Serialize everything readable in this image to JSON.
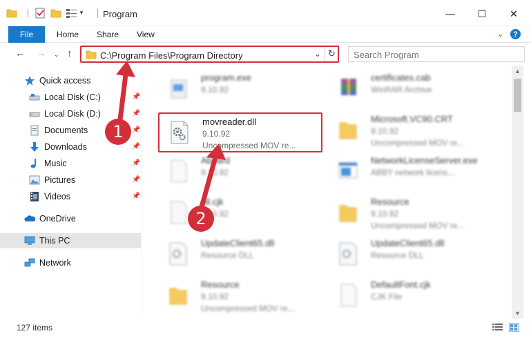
{
  "window": {
    "title": "Program",
    "minimize": "—",
    "maximize": "☐",
    "close": "✕"
  },
  "ribbon": {
    "file": "File",
    "tabs": [
      "Home",
      "Share",
      "View"
    ],
    "expand": "⌄",
    "help": "?"
  },
  "address": {
    "path": "C:\\Program Files\\Program Directory",
    "search_placeholder": "Search Program"
  },
  "nav": {
    "items": [
      {
        "label": "Quick access",
        "icon": "star-icon",
        "pinned": false
      },
      {
        "label": "Local Disk (C:)",
        "icon": "drive-icon",
        "pinned": true
      },
      {
        "label": "Local Disk (D:)",
        "icon": "drive-icon",
        "pinned": true
      },
      {
        "label": "Documents",
        "icon": "documents-icon",
        "pinned": true
      },
      {
        "label": "Downloads",
        "icon": "download-icon",
        "pinned": true
      },
      {
        "label": "Music",
        "icon": "music-icon",
        "pinned": true
      },
      {
        "label": "Pictures",
        "icon": "pictures-icon",
        "pinned": true
      },
      {
        "label": "Videos",
        "icon": "videos-icon",
        "pinned": true
      },
      {
        "label": "OneDrive",
        "icon": "cloud-icon",
        "pinned": false
      },
      {
        "label": "This PC",
        "icon": "computer-icon",
        "pinned": false,
        "selected": true
      },
      {
        "label": "Network",
        "icon": "network-icon",
        "pinned": false
      }
    ]
  },
  "files": [
    {
      "name": "program.exe",
      "sub1": "9.10.92",
      "sub2": "",
      "icon": "exe-icon",
      "blurred": true
    },
    {
      "name": "certificates.cab",
      "sub1": "WinRAR Archive",
      "sub2": "",
      "icon": "archive-icon",
      "blurred": true
    },
    {
      "name": "movreader.dll",
      "sub1": "9.10.92",
      "sub2": "Uncompressed MOV re...",
      "icon": "dll-gear-icon",
      "blurred": false
    },
    {
      "name": "Microsoft.VC90.CRT",
      "sub1": "9.10.92",
      "sub2": "Uncompressed MOV re...",
      "icon": "folder-icon",
      "blurred": true
    },
    {
      "name": "Aboard",
      "sub1": "9.10.92",
      "sub2": "",
      "icon": "file-icon",
      "blurred": true
    },
    {
      "name": "NetworkLicenseServer.exe",
      "sub1": "ABBY network licens...",
      "sub2": "",
      "icon": "app-window-icon",
      "blurred": true
    },
    {
      "name": "dll.cjk",
      "sub1": "9.10.92",
      "sub2": "",
      "icon": "file-icon",
      "blurred": true
    },
    {
      "name": "Resource",
      "sub1": "9.10.92",
      "sub2": "Uncompressed MOV re...",
      "icon": "folder-icon",
      "blurred": true
    },
    {
      "name": "UpdateClient65.dll",
      "sub1": "Resource DLL",
      "sub2": "",
      "icon": "dll-gear-icon",
      "blurred": true
    },
    {
      "name": "UpdateClient65.dll",
      "sub1": "Resource DLL",
      "sub2": "",
      "icon": "dll-gear-icon",
      "blurred": true
    },
    {
      "name": "Resource",
      "sub1": "9.10.92",
      "sub2": "Uncompressed MOV re...",
      "icon": "folder-icon",
      "blurred": true
    },
    {
      "name": "DefaultFont.cjk",
      "sub1": "CJK File",
      "sub2": "",
      "icon": "file-icon",
      "blurred": true
    }
  ],
  "status": {
    "count": "127 items"
  },
  "annotations": [
    {
      "label": "1"
    },
    {
      "label": "2"
    }
  ],
  "colors": {
    "accent": "#1979ca",
    "highlight": "#d32f3a",
    "folder": "#f5c342"
  }
}
